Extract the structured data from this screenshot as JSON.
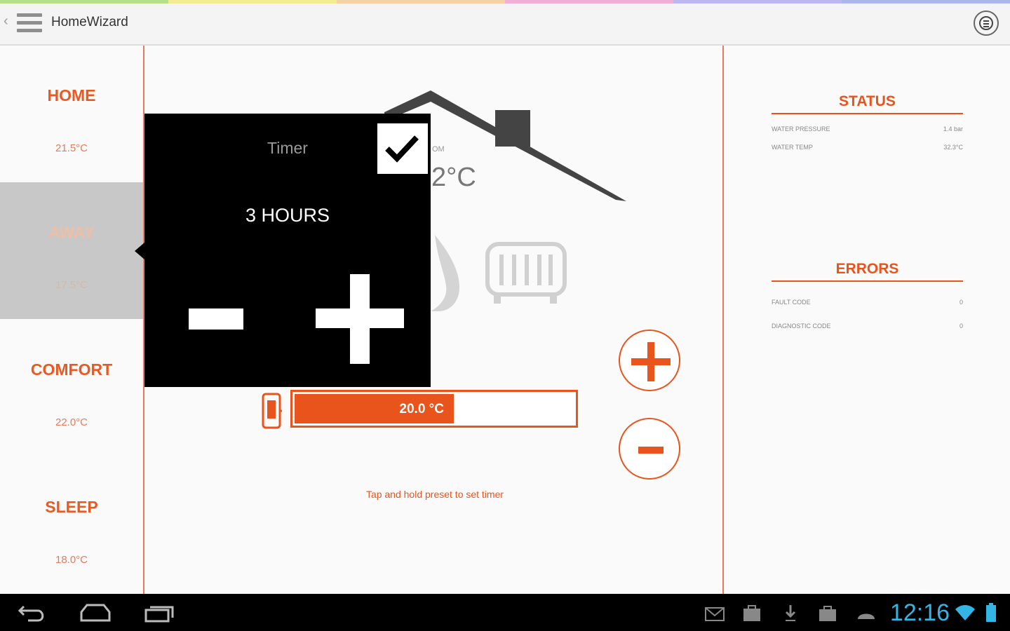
{
  "colors": {
    "accent": "#e8541c",
    "divider": "#e77a5a",
    "rainbow": [
      "#b7e08c",
      "#f2ec93",
      "#f6cfa5",
      "#efb1d3",
      "#bfb7ef",
      "#aab7e8"
    ],
    "clock": "#33b5e5"
  },
  "app": {
    "title": "HomeWizard",
    "menu_icon": "drawer-icon",
    "overflow_icon": "settings-icon"
  },
  "presets": [
    {
      "name": "HOME",
      "temp": "21.5°C",
      "active": false
    },
    {
      "name": "AWAY",
      "temp": "17.5°C",
      "active": true
    },
    {
      "name": "COMFORT",
      "temp": "22.0°C",
      "active": false
    },
    {
      "name": "SLEEP",
      "temp": "18.0°C",
      "active": false
    }
  ],
  "room": {
    "label": "OM",
    "temp": "2°C"
  },
  "timer": {
    "title": "Timer",
    "value": "3 HOURS",
    "checked": true
  },
  "thermostat": {
    "setpoint": "20.0 °C",
    "fill_fraction": 0.57
  },
  "hint": "Tap and hold preset to set timer",
  "status": {
    "title": "STATUS",
    "rows": [
      {
        "label": "WATER PRESSURE",
        "value": "1.4 bar"
      },
      {
        "label": "WATER TEMP",
        "value": "32.3°C"
      }
    ]
  },
  "errors": {
    "title": "ERRORS",
    "rows": [
      {
        "label": "FAULT CODE",
        "value": "0"
      },
      {
        "label": "DIAGNOSTIC CODE",
        "value": "0"
      }
    ]
  },
  "system": {
    "time": "12:16"
  }
}
